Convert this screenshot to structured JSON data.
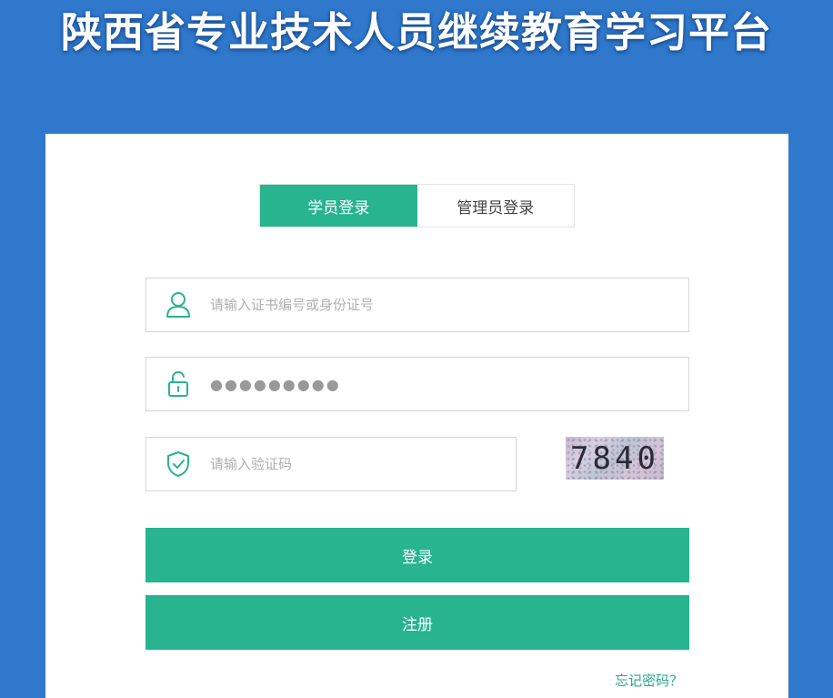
{
  "site": {
    "title": "陕西省专业技术人员继续教育学习平台"
  },
  "tabs": [
    {
      "label": "学员登录",
      "active": true
    },
    {
      "label": "管理员登录",
      "active": false
    }
  ],
  "form": {
    "username": {
      "placeholder": "请输入证书编号或身份证号",
      "value": "",
      "icon": "user-icon"
    },
    "password": {
      "value": "●●●●●●●●●",
      "icon": "lock-icon"
    },
    "captcha_input": {
      "placeholder": "请输入验证码",
      "value": "",
      "icon": "shield-check-icon"
    },
    "captcha_text": "7840"
  },
  "buttons": {
    "login": "登录",
    "register": "注册"
  },
  "links": {
    "forgot_password": "忘记密码？"
  },
  "colors": {
    "background": "#2f78cc",
    "accent": "#27b48f"
  }
}
